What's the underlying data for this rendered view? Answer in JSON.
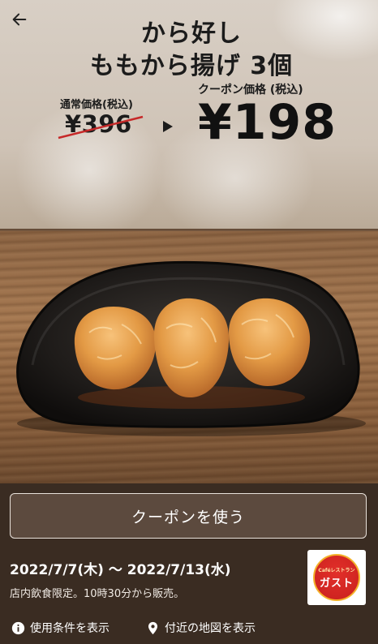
{
  "header": {
    "title_line1": "から好し",
    "title_line2": "ももから揚げ 3個"
  },
  "pricing": {
    "regular_label": "通常価格(税込)",
    "regular_price": "¥396",
    "coupon_label": "クーポン価格 (税込)",
    "coupon_price": "¥198"
  },
  "actions": {
    "use_coupon_label": "クーポンを使う",
    "terms_label": "使用条件を表示",
    "map_label": "付近の地図を表示"
  },
  "validity": {
    "period": "2022/7/7(木) 〜 2022/7/13(水)",
    "note": "店内飲食限定。10時30分から販売。"
  },
  "brand": {
    "logo_sub": "Caféレストラン",
    "logo_main": "ガスト"
  },
  "icons": {
    "back": "arrow-left-icon",
    "info": "info-icon",
    "location": "location-pin-icon"
  },
  "colors": {
    "panel_bg": "#3a2c22",
    "strike_red": "#c62828",
    "logo_red": "#d42826",
    "logo_gold": "#f4b12a"
  }
}
